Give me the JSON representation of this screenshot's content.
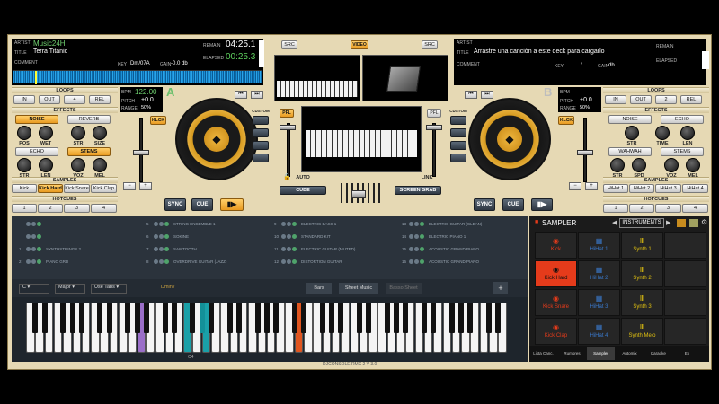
{
  "deckA": {
    "artist_label": "ARTIST",
    "artist": "Music24H",
    "title_label": "TITLE",
    "title": "Terra Titanic",
    "comment_label": "COMMENT",
    "remain_label": "REMAIN",
    "remain": "04:25.1",
    "elapsed_label": "ELAPSED",
    "elapsed": "00:25.3",
    "key_label": "KEY",
    "key": "Dm/07A",
    "gain_label": "GAIN",
    "gain": "-0.0 db",
    "bpm_label": "BPM",
    "bpm": "122.00",
    "pitch_label": "PITCH",
    "pitch": "+0.0",
    "range_label": "RANGE",
    "range": "50%",
    "letter": "A",
    "loops_label": "LOOPS",
    "loops": [
      "IN",
      "OUT",
      "4",
      "REL"
    ],
    "effects_label": "EFFECTS",
    "fx1": "NOISE",
    "fx2": "REVERB",
    "fx1_params": [
      "POS",
      "WET"
    ],
    "fx2_params": [
      "STR",
      "SIZE"
    ],
    "fx3": "ECHO",
    "fx4": "STEMS",
    "fx3_params": [
      "STR",
      "LEN"
    ],
    "fx4_params": [
      "VOZ",
      "MEL"
    ],
    "samples_label": "SAMPLES",
    "samples": [
      "Kick",
      "Kick Hard",
      "Kick Snare",
      "Kick Clap"
    ],
    "hotcues_label": "HOTCUES",
    "hotcues": [
      "1",
      "2",
      "3",
      "4"
    ],
    "klck": "KLCK",
    "custom": "CUSTOM",
    "pfl": "PFL",
    "sync": "SYNC",
    "cue": "CUE",
    "play_icon": "play-pause"
  },
  "deckB": {
    "artist_label": "ARTIST",
    "title_label": "TITLE",
    "title": "Arrastre una canción a este deck para cargarlo",
    "comment_label": "COMMENT",
    "remain_label": "REMAIN",
    "elapsed_label": "ELAPSED",
    "key_label": "KEY",
    "key": "/",
    "gain_label": "GAIN",
    "gain": "db",
    "bpm_label": "BPM",
    "pitch_label": "PITCH",
    "pitch": "+0.0",
    "range_label": "RANGE",
    "range": "50%",
    "letter": "B",
    "loops_label": "LOOPS",
    "loops": [
      "IN",
      "OUT",
      "2",
      "REL"
    ],
    "effects_label": "EFFECTS",
    "fx1": "NOISE",
    "fx2": "ECHO",
    "fx1_params": [
      "STR",
      "TIME",
      "LEN"
    ],
    "fx3": "WAHWAH",
    "fx4": "STEMS",
    "fx3_params": [
      "STR",
      "SPD"
    ],
    "fx4_params": [
      "VOZ",
      "MEL"
    ],
    "samples_label": "SAMPLES",
    "samples": [
      "HiHat 1",
      "HiHat 2",
      "HiHat 3",
      "HiHat 4"
    ],
    "hotcues_label": "HOTCUES",
    "hotcues": [
      "1",
      "2",
      "3",
      "4"
    ],
    "klck": "KLCK",
    "custom": "CUSTOM",
    "pfl": "PFL",
    "sync": "SYNC",
    "cue": "CUE"
  },
  "center": {
    "src": "SRC",
    "video": "VIDEO",
    "auto": "AUTO",
    "link": "LINK",
    "cube": "CUBE",
    "screen_grab": "SCREEN GRAB"
  },
  "instruments": [
    {
      "n": "",
      "name": ""
    },
    {
      "n": "",
      "name": ""
    },
    {
      "n": "1",
      "name": "SYNTHSTRINGS 2"
    },
    {
      "n": "2",
      "name": "PIANO GRD"
    },
    {
      "n": "5",
      "name": "STRING ENSEMBLE 1"
    },
    {
      "n": "6",
      "name": "SOKINE"
    },
    {
      "n": "7",
      "name": "SAWTOOTH"
    },
    {
      "n": "8",
      "name": "OVERDRIVE GUITAR (JAZZ)"
    },
    {
      "n": "9",
      "name": "ELECTRIC BASS 1"
    },
    {
      "n": "10",
      "name": "STANDARD KIT"
    },
    {
      "n": "11",
      "name": "ELECTRIC GUITAR (MUTED)"
    },
    {
      "n": "12",
      "name": "DISTORTION GUITAR"
    },
    {
      "n": "13",
      "name": "ELECTRIC GUITAR (CLEAN)"
    },
    {
      "n": "14",
      "name": "ELECTRIC PIANO 1"
    },
    {
      "n": "15",
      "name": "ACOUSTIC GRAND PIANO"
    },
    {
      "n": "16",
      "name": "ACOUSTIC GRAND PIANO"
    }
  ],
  "keyboard": {
    "key": "C",
    "scale": "Major",
    "mode": "Use Tabs",
    "chord": "Dmin7",
    "bars": "Bars",
    "sheet": "Sheet Music",
    "bass_sheet": "Basso Sheet",
    "plus": "+",
    "octave": "C4"
  },
  "sampler": {
    "title": "SAMPLER",
    "bank": "INSTRUMENTS",
    "pads": [
      {
        "label": "Kick",
        "color": "#e53b1b",
        "icon": "drum"
      },
      {
        "label": "HiHat 1",
        "color": "#3a78c9",
        "icon": "grid"
      },
      {
        "label": "Synth 1",
        "color": "#e0c010",
        "icon": "bars"
      },
      {
        "label": "",
        "color": "#262626",
        "icon": ""
      },
      {
        "label": "Kick Hard",
        "color": "#e53b1b",
        "icon": "drum"
      },
      {
        "label": "HiHat 2",
        "color": "#3a78c9",
        "icon": "grid"
      },
      {
        "label": "Synth 2",
        "color": "#e0c010",
        "icon": "bars"
      },
      {
        "label": "",
        "color": "#262626",
        "icon": ""
      },
      {
        "label": "Kick Snare",
        "color": "#e53b1b",
        "icon": "drum"
      },
      {
        "label": "HiHat 3",
        "color": "#3a78c9",
        "icon": "grid"
      },
      {
        "label": "Synth 3",
        "color": "#e0c010",
        "icon": "bars"
      },
      {
        "label": "",
        "color": "#262626",
        "icon": ""
      },
      {
        "label": "Kick Clap",
        "color": "#e53b1b",
        "icon": "drum"
      },
      {
        "label": "HiHat 4",
        "color": "#3a78c9",
        "icon": "grid"
      },
      {
        "label": "Synth Melo",
        "color": "#e0c010",
        "icon": "bars"
      },
      {
        "label": "",
        "color": "#262626",
        "icon": ""
      }
    ],
    "active_pad": "Kick Hard"
  },
  "tabs": [
    "Lista Canc.",
    "Rumores",
    "Sampler",
    "Automix",
    "Karaoke",
    "Ex"
  ],
  "footer": "DJCONSOLE RMX 2 V 3.0"
}
